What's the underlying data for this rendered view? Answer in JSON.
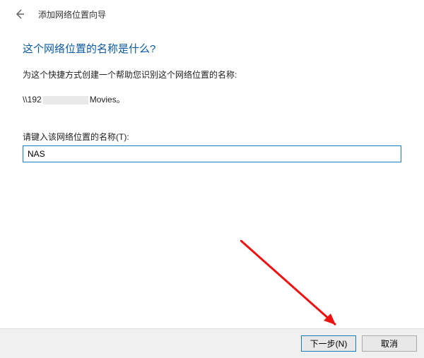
{
  "titlebar": {
    "window_title": "添加网络位置向导"
  },
  "main": {
    "heading": "这个网络位置的名称是什么?",
    "instruction": "为这个快捷方式创建一个帮助您识别这个网络位置的名称:",
    "path_prefix": "\\\\192",
    "path_suffix": "Movies。",
    "input_label": "请键入该网络位置的名称(T):",
    "input_value": "NAS"
  },
  "buttons": {
    "next": "下一步(N)",
    "cancel": "取消"
  }
}
